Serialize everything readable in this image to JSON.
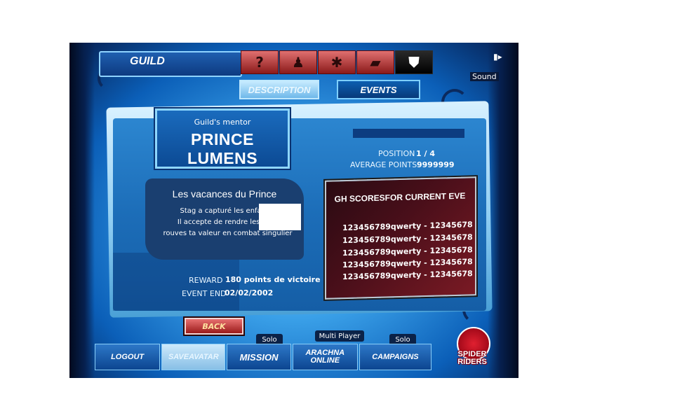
{
  "header": {
    "title": "GUILD",
    "tabs": [
      {
        "icon": "question-icon",
        "glyph": "?"
      },
      {
        "icon": "person-icon",
        "glyph": "♟"
      },
      {
        "icon": "spider-icon",
        "glyph": "✱"
      },
      {
        "icon": "cards-icon",
        "glyph": "▰"
      },
      {
        "icon": "shield-icon",
        "glyph": "⛊"
      }
    ],
    "sound_label": "Sound",
    "sound_icon": "speaker-icon"
  },
  "subtabs": {
    "description": "DESCRIPTION",
    "events": "EVENTS"
  },
  "mentor": {
    "label": "Guild's mentor",
    "name": "PRINCE LUMENS"
  },
  "stats": {
    "position_label": "POSITION",
    "position_value": "1 / 4",
    "average_label": "AVERAGE POINTS",
    "average_value": "9999999"
  },
  "event": {
    "title": "Les vacances du Prince",
    "lines": [
      "Stag a capturé les enfant d",
      "Il accepte de rendre les otag",
      "rouves ta valeur en combat singulier"
    ],
    "reward_label": "REWARD",
    "reward_value": "180 points de victoire",
    "end_label": "EVENT END",
    "end_value": "02/02/2002"
  },
  "scores": {
    "title": "GH SCORESFOR CURRENT EVE",
    "rows": [
      "123456789qwerty - 12345678",
      "123456789qwerty - 12345678",
      "123456789qwerty - 12345678",
      "123456789qwerty - 12345678",
      "123456789qwerty - 12345678"
    ]
  },
  "back_label": "BACK",
  "bottom": {
    "logout": "LOGOUT",
    "save_avatar": "SAVEAVATAR",
    "mission": "MISSION",
    "aracnina_line1": "ARACHNA",
    "aracnina_line2": "ONLINE",
    "campaigns": "CAMPAIGNS",
    "badge_solo_1": "Solo",
    "badge_multi": "Multi Player",
    "badge_solo_2": "Solo"
  },
  "logo": {
    "line1": "SPIDER",
    "line2": "RIDERS"
  },
  "colors": {
    "accent_blue": "#1c6db8",
    "tab_red": "#8b1a1a",
    "scores_bg": "#4a0f1a"
  }
}
